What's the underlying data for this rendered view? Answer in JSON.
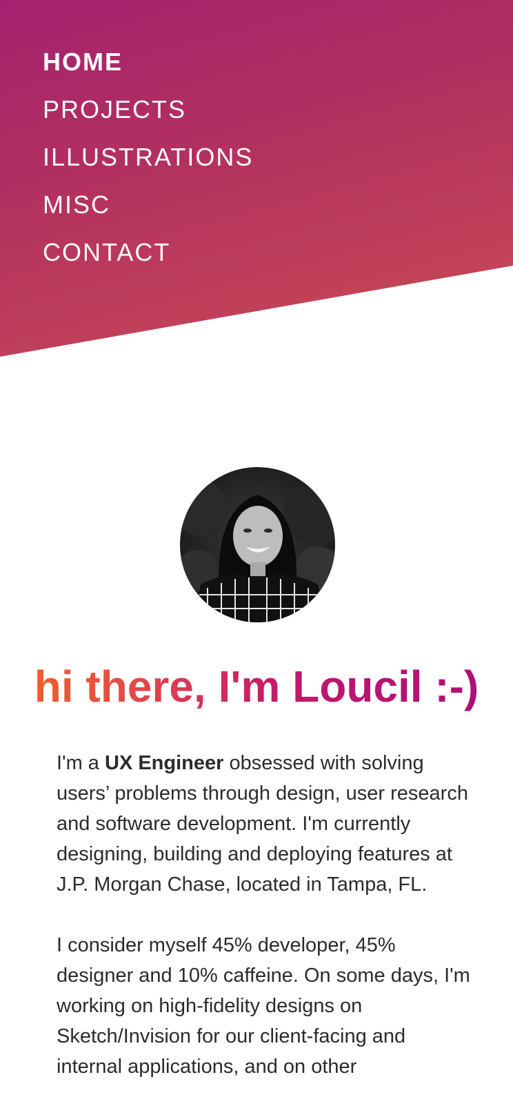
{
  "nav": {
    "items": [
      {
        "label": "HOME",
        "active": true
      },
      {
        "label": "PROJECTS",
        "active": false
      },
      {
        "label": "ILLUSTRATIONS",
        "active": false
      },
      {
        "label": "MISC",
        "active": false
      },
      {
        "label": "CONTACT",
        "active": false
      }
    ]
  },
  "profile": {
    "photo_alt": "Loucil portrait"
  },
  "hero": {
    "greeting": "hi there, I'm Loucil :-)"
  },
  "bio": {
    "p1_prefix": "I'm a ",
    "p1_emphasis": "UX Engineer",
    "p1_suffix": " obsessed with solving users’ problems through design, user research and software development. I'm currently designing, building and deploying features at J.P. Morgan Chase, located in Tampa, FL.",
    "p2": "I consider myself 45% developer, 45% designer and 10% caffeine. On some days, I'm working on high-fidelity designs on Sketch/Invision for our client-facing and internal applications, and on other"
  },
  "colors": {
    "band_top": "#a3226f",
    "band_bottom": "#cb4c55",
    "greeting_start": "#f26522",
    "greeting_end": "#a80f7a",
    "body_text": "#2b2b2b"
  }
}
